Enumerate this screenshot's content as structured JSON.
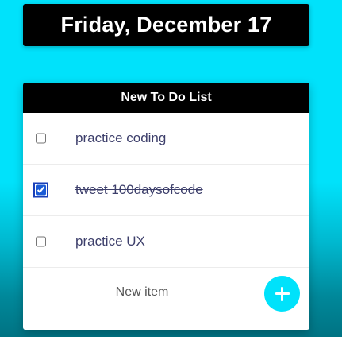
{
  "date": {
    "label": "Friday, December 17"
  },
  "list": {
    "title": "New To Do List",
    "items": [
      {
        "label": "practice coding",
        "checked": false
      },
      {
        "label": "tweet 100daysofcode",
        "checked": true
      },
      {
        "label": "practice UX",
        "checked": false
      }
    ]
  },
  "new_item": {
    "placeholder": "New item",
    "add_icon": "plus-icon"
  },
  "colors": {
    "accent": "#00e2fb",
    "header_bg": "#000000",
    "item_text": "#3d3f6b"
  }
}
